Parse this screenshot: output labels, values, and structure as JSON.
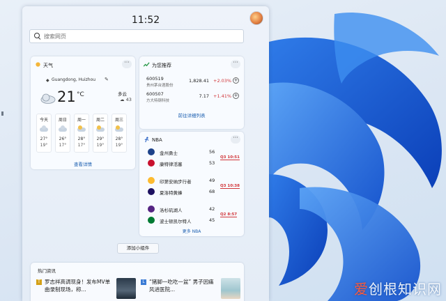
{
  "clock": "11:52",
  "search": {
    "placeholder": "搜索网页"
  },
  "weather": {
    "title": "天气",
    "location": "Guangdong, Huizhou",
    "temp": "21",
    "unit": "°C",
    "condition": "多云",
    "aqi": "43",
    "forecast": [
      {
        "day": "今天",
        "hi": "27°",
        "lo": "19°",
        "icon": "cloud"
      },
      {
        "day": "周日",
        "hi": "26°",
        "lo": "17°",
        "icon": "cloud"
      },
      {
        "day": "周一",
        "hi": "28°",
        "lo": "17°",
        "icon": "sun"
      },
      {
        "day": "周二",
        "hi": "29°",
        "lo": "19°",
        "icon": "sun"
      },
      {
        "day": "周三",
        "hi": "28°",
        "lo": "19°",
        "icon": "sun"
      }
    ],
    "link": "查看详情",
    "more": "···"
  },
  "stocks": {
    "title": "为您推荐",
    "items": [
      {
        "code": "600519",
        "name": "贵州茅台酒股份",
        "price": "1,828.41",
        "change": "+2.03%"
      },
      {
        "code": "600507",
        "name": "方大特钢科技",
        "price": "7.17",
        "change": "+1.41%"
      }
    ],
    "link": "前往详细列表",
    "more": "···"
  },
  "nba": {
    "title": "NBA",
    "matches": [
      {
        "teams": [
          {
            "name": "金州勇士",
            "score": "56",
            "color": "#1d428a"
          },
          {
            "name": "康特律活塞",
            "score": "53",
            "color": "#c8102e"
          }
        ],
        "status": "Q3 10:51"
      },
      {
        "teams": [
          {
            "name": "印第安纳步行者",
            "score": "49",
            "color": "#fdbb30"
          },
          {
            "name": "夏洛特黄蜂",
            "score": "68",
            "color": "#1d1160"
          }
        ],
        "status": "Q3 10:38"
      },
      {
        "teams": [
          {
            "name": "洛杉矶湖人",
            "score": "42",
            "color": "#552583"
          },
          {
            "name": "波士顿凯尔特人",
            "score": "45",
            "color": "#007a33"
          }
        ],
        "status": "Q2 8:57"
      }
    ],
    "link": "更多 NBA",
    "more": "···"
  },
  "add_widget": "添加小组件",
  "news": {
    "title": "热门资讯",
    "items": [
      {
        "headline": "罗志祥高调现身！发布MV单曲录制现场，称...",
        "source": "T"
      },
      {
        "headline": "“猪脚一吃吃一盆” 男子因痛风进医院...",
        "source": "L"
      }
    ]
  },
  "watermark": {
    "part1": "爱",
    "part2": "创根知识网"
  }
}
